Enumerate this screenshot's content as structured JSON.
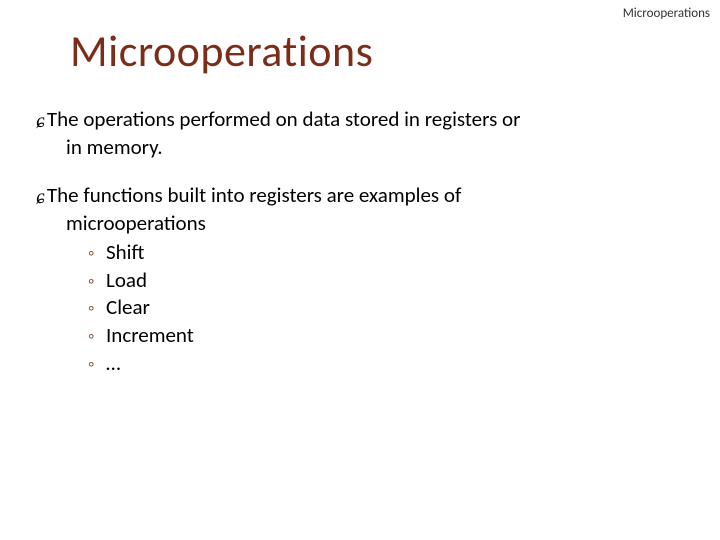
{
  "header": {
    "label": "Microoperations"
  },
  "title": "Microoperations",
  "bullets": [
    {
      "line1": "The operations performed on data stored in registers or",
      "line2": "in memory.",
      "subs": []
    },
    {
      "line1": "The functions built into registers are examples of",
      "line2": "microoperations",
      "subs": [
        "Shift",
        "Load",
        "Clear",
        "Increment",
        "…"
      ]
    }
  ]
}
